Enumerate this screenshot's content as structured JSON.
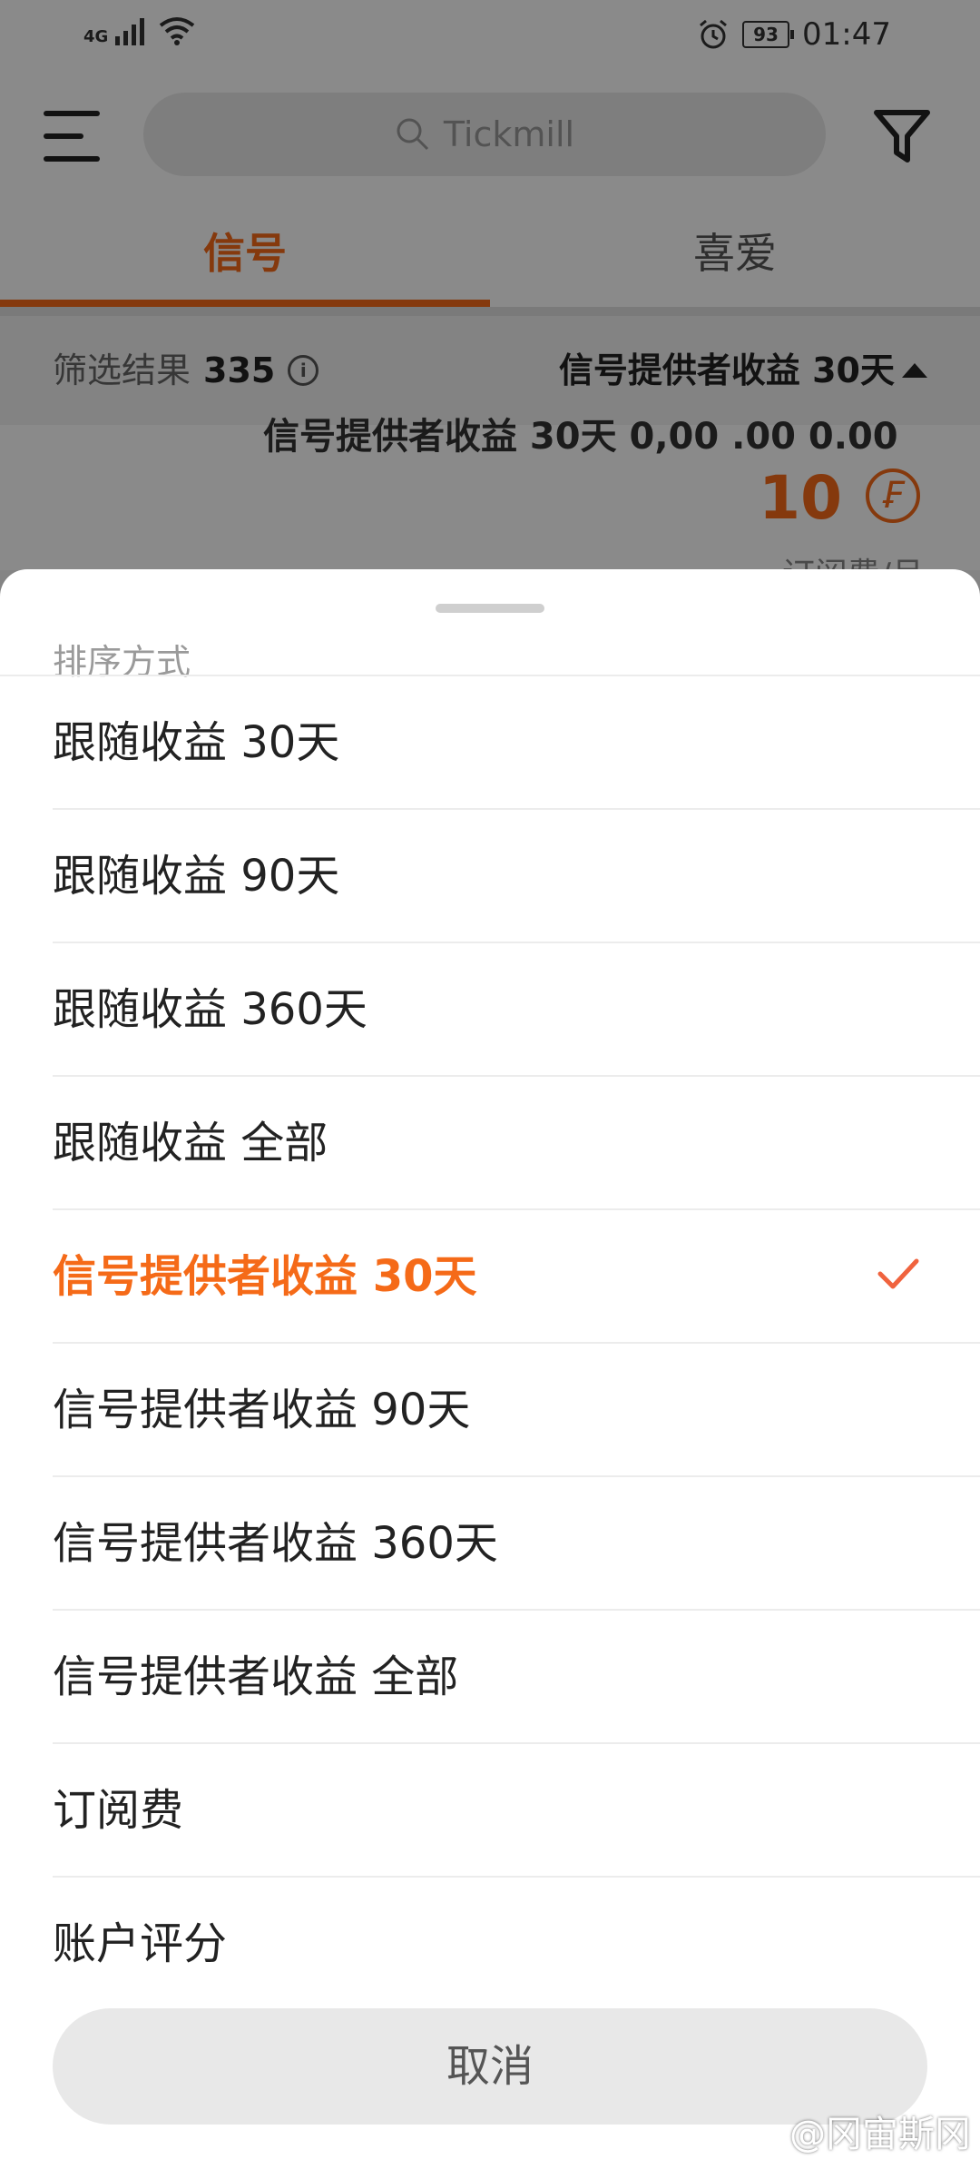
{
  "status_bar": {
    "network": "4G",
    "battery": "93",
    "time": "01:47",
    "icons": [
      "signal-icon",
      "wifi-icon",
      "alarm-icon",
      "battery-icon"
    ]
  },
  "search": {
    "placeholder": "Tickmill"
  },
  "tabs": [
    {
      "label": "信号",
      "active": true
    },
    {
      "label": "喜爱",
      "active": false
    }
  ],
  "filter_bar": {
    "label": "筛选结果",
    "count": "335",
    "sort_label": "信号提供者收益 30天"
  },
  "card": {
    "partial_text": "信号提供者收益 30天 0,00 .00 0.00",
    "fee_value": "10",
    "fee_symbol": "₣",
    "fee_unit": "订阅费/月"
  },
  "sort_sheet": {
    "title": "排序方式",
    "options": [
      {
        "label": "跟随收益 30天",
        "selected": false
      },
      {
        "label": "跟随收益 90天",
        "selected": false
      },
      {
        "label": "跟随收益 360天",
        "selected": false
      },
      {
        "label": "跟随收益 全部",
        "selected": false
      },
      {
        "label": "信号提供者收益 30天",
        "selected": true
      },
      {
        "label": "信号提供者收益 90天",
        "selected": false
      },
      {
        "label": "信号提供者收益 360天",
        "selected": false
      },
      {
        "label": "信号提供者收益 全部",
        "selected": false
      },
      {
        "label": "订阅费",
        "selected": false
      },
      {
        "label": "账户评分",
        "selected": false
      }
    ],
    "cancel_label": "取消"
  },
  "watermark": "@冈宙斯冈",
  "colors": {
    "accent": "#f56a18",
    "check": "#f0633e"
  }
}
